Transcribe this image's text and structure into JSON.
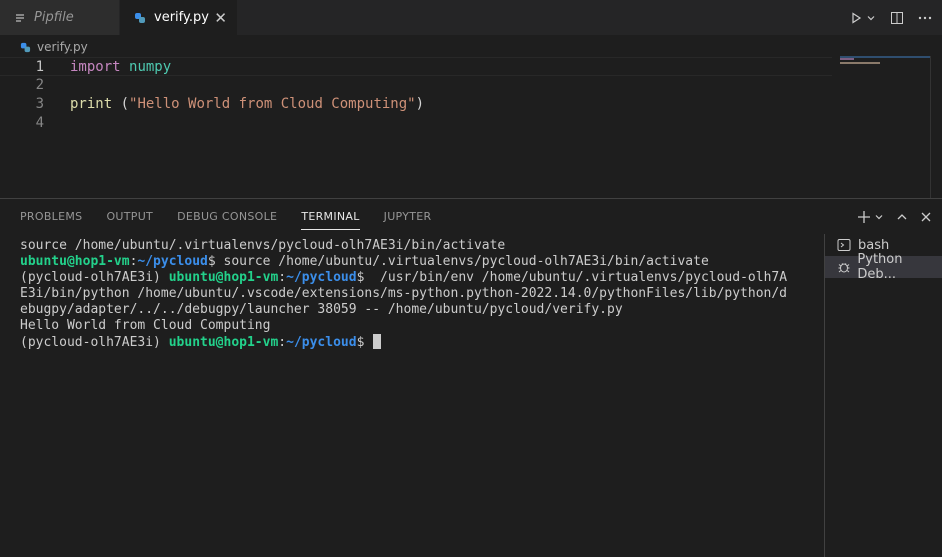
{
  "tabs": [
    {
      "label": "Pipfile",
      "icon": "lines-icon"
    },
    {
      "label": "verify.py",
      "icon": "python-icon",
      "close": "✕"
    }
  ],
  "breadcrumb": {
    "file": "verify.py"
  },
  "editor": {
    "lines": [
      {
        "num": "1",
        "tokens": [
          {
            "t": "import",
            "c": "kw"
          },
          {
            "t": " ",
            "c": ""
          },
          {
            "t": "numpy",
            "c": "mod"
          }
        ]
      },
      {
        "num": "2",
        "tokens": []
      },
      {
        "num": "3",
        "tokens": [
          {
            "t": "print",
            "c": "fn"
          },
          {
            "t": " (",
            "c": "punc"
          },
          {
            "t": "\"Hello World from Cloud Computing\"",
            "c": "str"
          },
          {
            "t": ")",
            "c": "punc"
          }
        ]
      },
      {
        "num": "4",
        "tokens": []
      }
    ]
  },
  "panel": {
    "tabs": [
      "PROBLEMS",
      "OUTPUT",
      "DEBUG CONSOLE",
      "TERMINAL",
      "JUPYTER"
    ],
    "active_tab": "TERMINAL"
  },
  "terminal": {
    "lines": [
      [
        {
          "t": "source /home/ubuntu/.virtualenvs/pycloud-olh7AE3i/bin/activate",
          "c": ""
        }
      ],
      [
        {
          "t": "ubuntu@hop1-vm",
          "c": "t-user"
        },
        {
          "t": ":",
          "c": ""
        },
        {
          "t": "~/pycloud",
          "c": "t-path"
        },
        {
          "t": "$ source /home/ubuntu/.virtualenvs/pycloud-olh7AE3i/bin/activate",
          "c": ""
        }
      ],
      [
        {
          "t": "(pycloud-olh7AE3i) ",
          "c": ""
        },
        {
          "t": "ubuntu@hop1-vm",
          "c": "t-user"
        },
        {
          "t": ":",
          "c": ""
        },
        {
          "t": "~/pycloud",
          "c": "t-path"
        },
        {
          "t": "$  /usr/bin/env /home/ubuntu/.virtualenvs/pycloud-olh7A",
          "c": ""
        }
      ],
      [
        {
          "t": "E3i/bin/python /home/ubuntu/.vscode/extensions/ms-python.python-2022.14.0/pythonFiles/lib/python/d",
          "c": ""
        }
      ],
      [
        {
          "t": "ebugpy/adapter/../../debugpy/launcher 38059 -- /home/ubuntu/pycloud/verify.py",
          "c": ""
        }
      ],
      [
        {
          "t": "Hello World from Cloud Computing",
          "c": ""
        }
      ],
      [
        {
          "t": "(pycloud-olh7AE3i) ",
          "c": ""
        },
        {
          "t": "ubuntu@hop1-vm",
          "c": "t-user"
        },
        {
          "t": ":",
          "c": ""
        },
        {
          "t": "~/pycloud",
          "c": "t-path"
        },
        {
          "t": "$ ",
          "c": ""
        }
      ]
    ],
    "sessions": [
      {
        "label": "bash",
        "icon": "terminal-icon"
      },
      {
        "label": "Python Deb...",
        "icon": "bug-icon",
        "selected": true
      }
    ]
  },
  "colors": {
    "accent": "#3b8eea",
    "user": "#23d18b"
  }
}
